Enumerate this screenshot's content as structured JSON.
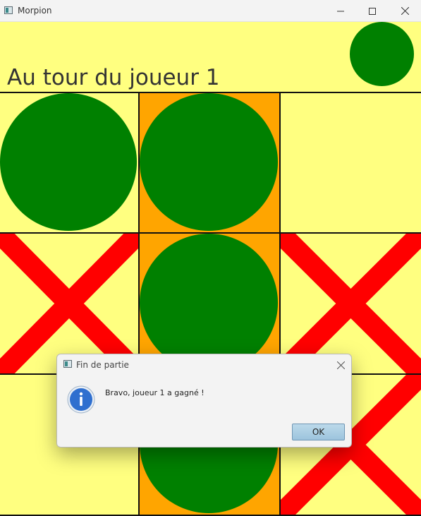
{
  "window": {
    "title": "Morpion",
    "icon": "app-icon",
    "controls": [
      "minimize-icon",
      "maximize-icon",
      "close-icon"
    ]
  },
  "header": {
    "status": "Au tour du joueur 1",
    "current_player_symbol": "circle"
  },
  "board": {
    "rows": 3,
    "cols": 3,
    "cells": [
      [
        "circle",
        "circle",
        "empty"
      ],
      [
        "cross",
        "circle",
        "cross"
      ],
      [
        "empty",
        "circle",
        "cross"
      ]
    ],
    "winning_cells": [
      [
        0,
        1
      ],
      [
        1,
        1
      ],
      [
        2,
        1
      ]
    ]
  },
  "colors": {
    "background": "#ffff80",
    "winning_highlight": "#ffa500",
    "circle": "#008000",
    "cross": "#ff0000",
    "grid_line": "#111111"
  },
  "dialog": {
    "title": "Fin de partie",
    "message": "Bravo, joueur 1 a gagné !",
    "icon": "info-icon",
    "ok_label": "OK"
  }
}
